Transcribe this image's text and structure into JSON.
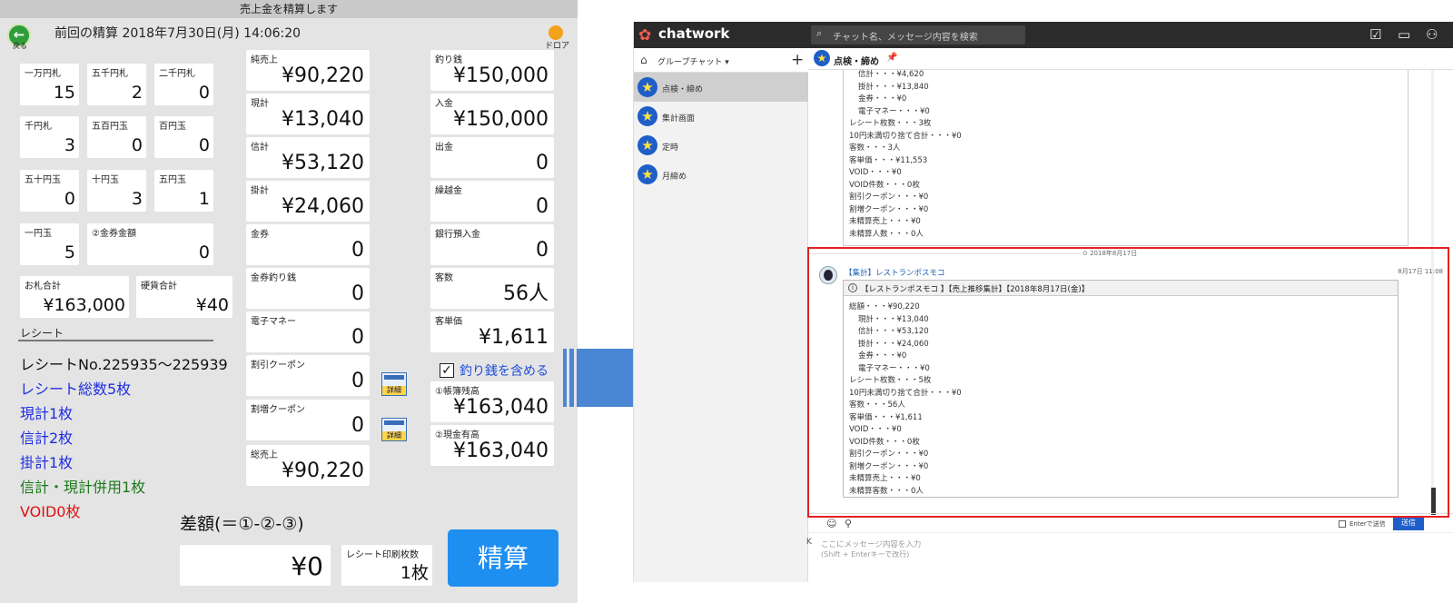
{
  "pos": {
    "window_title": "売上金を精算します",
    "back_label": "戻る",
    "prev_settlement": "前回の精算 2018年7月30日(月) 14:06:20",
    "drawer_label": "ドロア",
    "denominations": [
      {
        "label": "一万円札",
        "value": "15"
      },
      {
        "label": "五千円札",
        "value": "2"
      },
      {
        "label": "二千円札",
        "value": "0"
      },
      {
        "label": "千円札",
        "value": "3"
      },
      {
        "label": "五百円玉",
        "value": "0"
      },
      {
        "label": "百円玉",
        "value": "0"
      },
      {
        "label": "五十円玉",
        "value": "0"
      },
      {
        "label": "十円玉",
        "value": "3"
      },
      {
        "label": "五円玉",
        "value": "1"
      },
      {
        "label": "一円玉",
        "value": "5"
      },
      {
        "label": "②金券金額",
        "value": "0"
      }
    ],
    "bill_total": {
      "label": "お札合計",
      "value": "¥163,000"
    },
    "coin_total": {
      "label": "硬貨合計",
      "value": "¥40"
    },
    "receipt_section_label": "レシート",
    "receipt_lines": [
      {
        "text": "レシートNo.225935～225939",
        "color": "#111111"
      },
      {
        "text": "レシート総数5枚",
        "color": "#1f2ee0"
      },
      {
        "text": "現計1枚",
        "color": "#1f2ee0"
      },
      {
        "text": "信計2枚",
        "color": "#1f2ee0"
      },
      {
        "text": "掛計1枚",
        "color": "#1f2ee0"
      },
      {
        "text": "信計・現計併用1枚",
        "color": "#1a7a1a"
      },
      {
        "text": "VOID0枚",
        "color": "#e01010"
      }
    ],
    "sales": [
      {
        "label": "純売上",
        "value": "¥90,220"
      },
      {
        "label": "現計",
        "value": "¥13,040"
      },
      {
        "label": "信計",
        "value": "¥53,120"
      },
      {
        "label": "掛計",
        "value": "¥24,060"
      },
      {
        "label": "金券",
        "value": "0"
      },
      {
        "label": "金券釣り銭",
        "value": "0"
      },
      {
        "label": "電子マネー",
        "value": "0"
      },
      {
        "label": "割引クーポン",
        "value": "0"
      },
      {
        "label": "割増クーポン",
        "value": "0"
      },
      {
        "label": "総売上",
        "value": "¥90,220"
      }
    ],
    "detail_label": "詳細",
    "cash": [
      {
        "label": "釣り銭",
        "value": "¥150,000"
      },
      {
        "label": "入金",
        "value": "¥150,000"
      },
      {
        "label": "出金",
        "value": "0"
      },
      {
        "label": "繰越金",
        "value": "0"
      },
      {
        "label": "銀行預入金",
        "value": "0"
      },
      {
        "label": "客数",
        "value": "56人"
      },
      {
        "label": "客単価",
        "value": "¥1,611"
      }
    ],
    "include_change": {
      "label": "釣り銭を含める",
      "checked": true,
      "mark": "✓"
    },
    "book_balance": {
      "label": "①帳簿残高",
      "value": "¥163,040"
    },
    "cash_balance": {
      "label": "②現金有高",
      "value": "¥163,040"
    },
    "difference": {
      "label": "差額(＝①-②-③)",
      "value": "¥0"
    },
    "print_count": {
      "label": "レシート印刷枚数",
      "value": "1枚"
    },
    "settle_button": "精算"
  },
  "chatwork": {
    "logo": "chatwork",
    "search_placeholder": "チャット名、メッセージ内容を検索",
    "group_label": "グループチャット ▾",
    "plus": "+",
    "rooms": [
      "点検・締め",
      "集計画面",
      "定時",
      "月締め"
    ],
    "room_title": "点検・締め",
    "old_message_lines": [
      "信計・・・¥4,620",
      "掛計・・・¥13,840",
      "金券・・・¥0",
      "電子マネー・・・¥0",
      "レシート枚数・・・3枚",
      "10円未満切り捨て合計・・・¥0",
      "客数・・・3人",
      "客単価・・・¥11,553",
      "VOID・・・¥0",
      "VOID件数・・・0枚",
      "割引クーポン・・・¥0",
      "割増クーポン・・・¥0",
      "未精算売上・・・¥0",
      "未精算人数・・・0人"
    ],
    "date_separator": "⊙ 2018年8月17日",
    "sender": "【集計】レストランポスモコ",
    "time": "8月17日 11:08",
    "info_title": "【レストランポスモコ 】【売上推移集計】【2018年8月17日(金)】",
    "info_lines": [
      "総額・・・¥90,220",
      "現計・・・¥13,040",
      "信計・・・¥53,120",
      "掛計・・・¥24,060",
      "金券・・・¥0",
      "電子マネー・・・¥0",
      "レシート枚数・・・5枚",
      "10円未満切り捨て合計・・・¥0",
      "客数・・・56人",
      "客単価・・・¥1,611",
      "VOID・・・¥0",
      "VOID件数・・・0枚",
      "割引クーポン・・・¥0",
      "割増クーポン・・・¥0",
      "未精算売上・・・¥0",
      "未精算客数・・・0人"
    ],
    "enter_send_label": "Enterで送信",
    "send_button": "送信",
    "compose_placeholder": "ここにメッセージ内容を入力",
    "compose_hint": "(Shift + Enterキーで改行)",
    "k_mark": "K"
  },
  "colors": {
    "accent_blue": "#1f8ef1",
    "arrow_blue": "#4a86d4",
    "highlight_red": "#e62121",
    "chatwork_bar": "#2b2b2b"
  }
}
